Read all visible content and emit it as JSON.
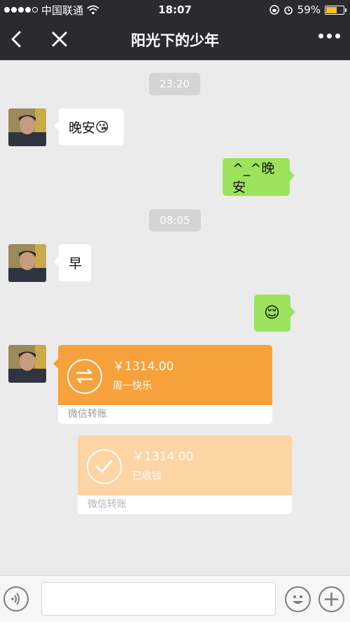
{
  "status_bar": {
    "carrier": "中国联通",
    "time": "18:07",
    "battery_percent": "59%",
    "battery_level": 0.59,
    "icons": [
      "signal-dots-icon",
      "wifi-icon",
      "orientation-lock-icon",
      "alarm-icon",
      "battery-icon"
    ]
  },
  "header": {
    "title": "阳光下的少年",
    "back_icon": "chevron-left-icon",
    "close_icon": "close-icon",
    "more_icon": "more-dots-icon"
  },
  "messages": [
    {
      "type": "time",
      "text": "23:20"
    },
    {
      "type": "text",
      "side": "left",
      "text": "晚安",
      "emoji": "😘"
    },
    {
      "type": "text",
      "side": "right",
      "text": "^_^晚安"
    },
    {
      "type": "time",
      "text": "08:05"
    },
    {
      "type": "text",
      "side": "left",
      "text": "早"
    },
    {
      "type": "emoji",
      "side": "right",
      "emoji": "😌"
    },
    {
      "type": "transfer",
      "side": "left",
      "amount": "￥1314.00",
      "note": "周一快乐",
      "footer": "微信转账",
      "state": "pending",
      "icon": "transfer-arrows-icon"
    },
    {
      "type": "transfer",
      "side": "right",
      "amount": "￥1314.00",
      "note": "已收钱",
      "footer": "微信转账",
      "state": "received",
      "icon": "checkmark-icon"
    }
  ],
  "input_bar": {
    "placeholder": "",
    "voice_icon": "voice-icon",
    "emoji_icon": "emoji-icon",
    "plus_icon": "plus-icon"
  },
  "colors": {
    "header_bg": "#2b2b2f",
    "chat_bg": "#ebebeb",
    "outgoing_bubble": "#9ce25c",
    "transfer_pending": "#f7a13c",
    "transfer_received": "#fdd4a3"
  }
}
